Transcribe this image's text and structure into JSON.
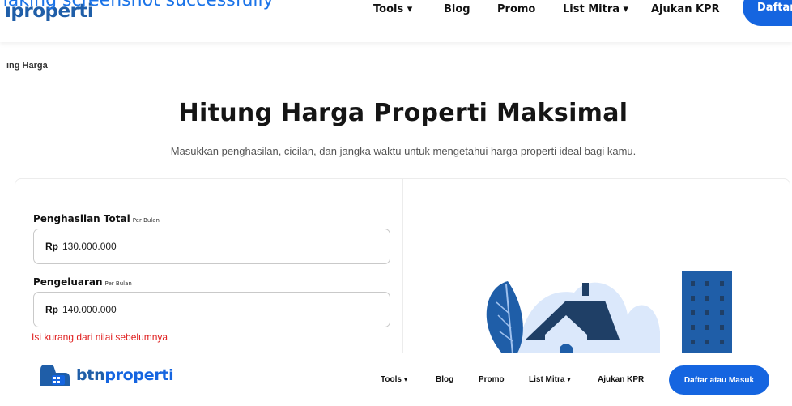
{
  "overlay": {
    "text": "Taking screenshot successfully"
  },
  "top_header": {
    "logo_text": "ıproperti",
    "nav": [
      {
        "label": "Tools ▾"
      },
      {
        "label": "Blog"
      },
      {
        "label": "Promo"
      },
      {
        "label": "List Mitra ▾"
      },
      {
        "label": "Ajukan KPR"
      }
    ],
    "register_label": "Daftar"
  },
  "breadcrumb": {
    "current": "ıng Harga"
  },
  "page": {
    "title": "Hitung Harga Properti Maksimal",
    "subtitle": "Masukkan penghasilan, cicilan, dan jangka waktu untuk mengetahui harga properti ideal bagi kamu."
  },
  "form": {
    "income": {
      "label": "Penghasilan Total",
      "unit": "Per Bulan",
      "currency": "Rp",
      "value": "130.000.000"
    },
    "expense": {
      "label": "Pengeluaran",
      "unit": "Per Bulan",
      "currency": "Rp",
      "value": "140.000.000"
    },
    "error": "Isi kurang dari nilai sebelumnya"
  },
  "sticky_header": {
    "brand_part1": "btn",
    "brand_part2": "properti",
    "nav": [
      {
        "label": "Tools"
      },
      {
        "label": "Blog"
      },
      {
        "label": "Promo"
      },
      {
        "label": "List Mitra"
      },
      {
        "label": "Ajukan KPR"
      }
    ],
    "caret": "▾",
    "register_label": "Daftar atau Masuk"
  },
  "colors": {
    "primary": "#1565e0",
    "brand_dark": "#1f5ea8",
    "error": "#e02020",
    "navy": "#1f3f66"
  }
}
